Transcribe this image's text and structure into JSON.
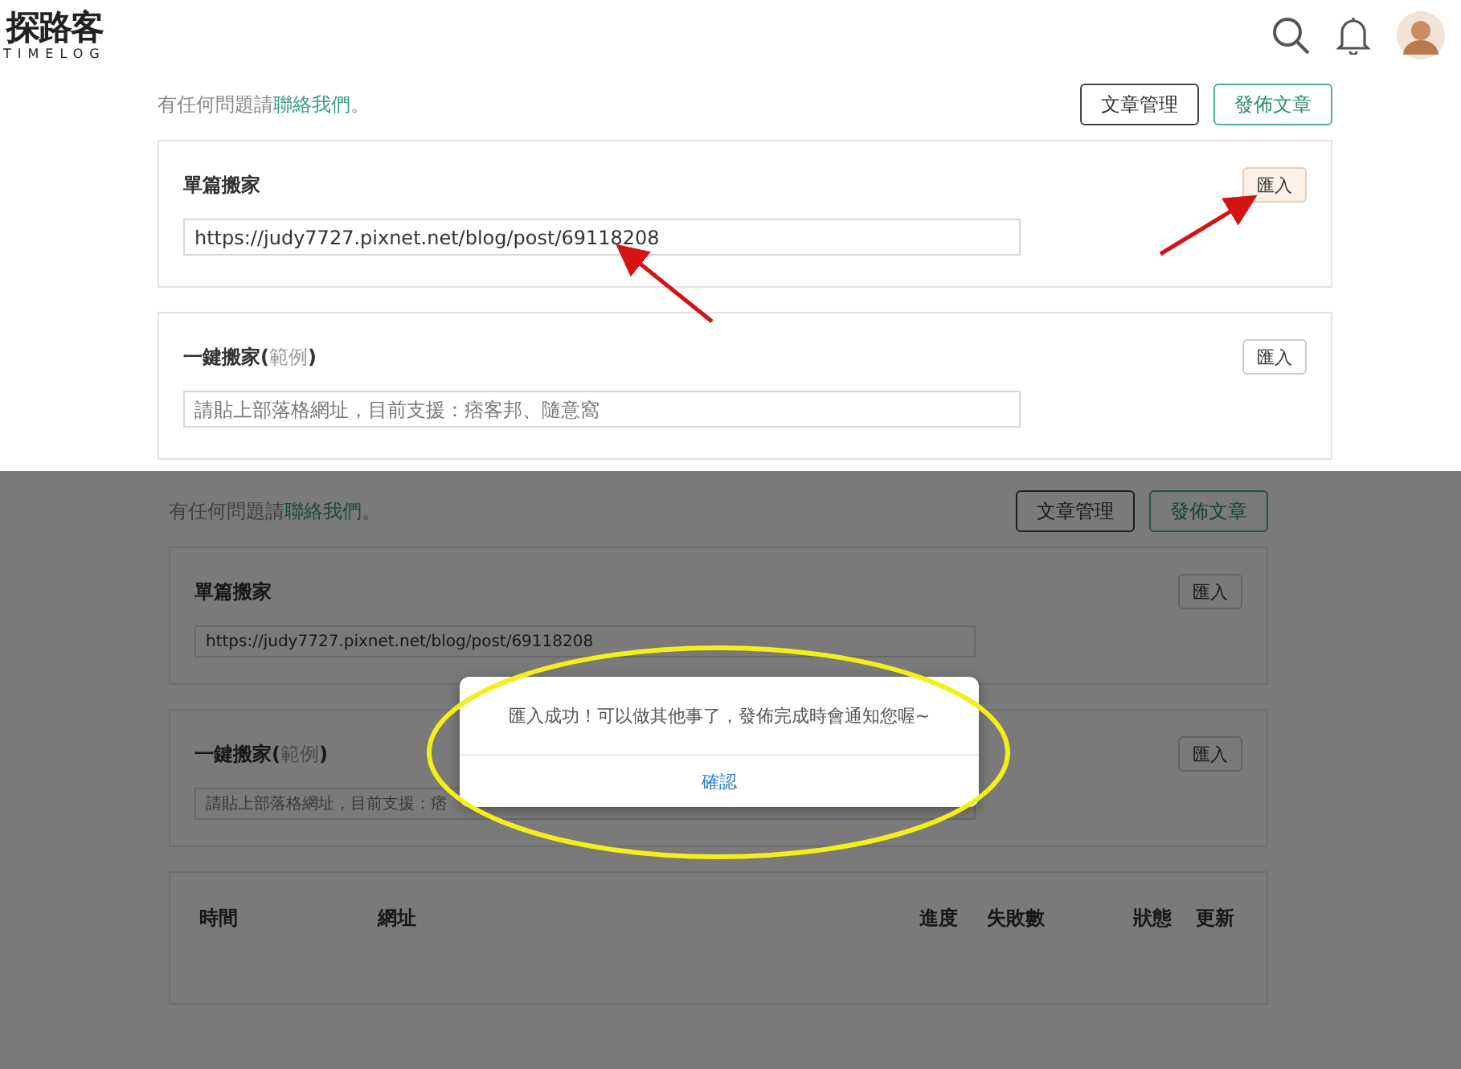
{
  "screens": [
    {
      "dimmed": false,
      "header": {
        "logo": "探路客",
        "logo_sub": "TIMELOG"
      },
      "notice": {
        "prefix": "有任何問題請 ",
        "link": "聯絡我們",
        "suffix": "。"
      },
      "buttons": [
        {
          "label": "文章管理",
          "kind": "outline"
        },
        {
          "label": "發佈文章",
          "kind": "primary"
        }
      ],
      "cards": [
        {
          "title": "單篇搬家",
          "import": "匯入",
          "highlighted": true,
          "value": "https://judy7727.pixnet.net/blog/post/69118208"
        },
        {
          "title": "一鍵搬家(",
          "example_link": "範例",
          "title_end": ")",
          "import": "匯入",
          "highlighted": false,
          "placeholder": "請貼上部落格網址，目前支援：痞客邦、隨意窩"
        }
      ]
    },
    {
      "dimmed": true,
      "notice": {
        "prefix": "有任何問題請 ",
        "link": "聯絡我們",
        "suffix": "。"
      },
      "buttons": [
        {
          "label": "文章管理",
          "kind": "outline"
        },
        {
          "label": "發佈文章",
          "kind": "primary"
        }
      ],
      "cards": [
        {
          "title": "單篇搬家",
          "import": "匯入",
          "highlighted": false,
          "value": "https://judy7727.pixnet.net/blog/post/69118208"
        },
        {
          "title": "一鍵搬家(",
          "example_link": "範例",
          "title_end": ")",
          "import": "匯入",
          "highlighted": false,
          "placeholder": "請貼上部落格網址，目前支援：痞"
        }
      ],
      "table": {
        "columns": [
          "時間",
          "網址",
          "進度",
          "失敗數",
          "狀態",
          "更新"
        ]
      },
      "dialog": {
        "message": "匯入成功！可以做其他事了，發佈完成時會通知您喔~",
        "button": "確認"
      }
    }
  ]
}
